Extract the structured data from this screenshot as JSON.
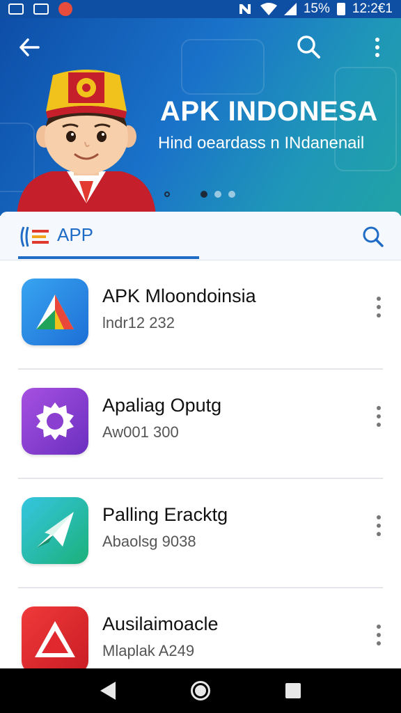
{
  "status_bar": {
    "time": "12:2€1",
    "battery": "15%"
  },
  "header": {
    "title": "APK INDONESA",
    "subtitle": "Hind oeardass n INdanenail",
    "carousel": {
      "count": 4,
      "active_index": 1
    }
  },
  "tab": {
    "label": "APP"
  },
  "apps": [
    {
      "name": "APK Mloondoinsia",
      "meta": "lndr12 232",
      "icon": "tent-triangle-icon",
      "color": "#2e8fe6"
    },
    {
      "name": "Apaliag Oputg",
      "meta": "Aw001 300",
      "icon": "gear-icon",
      "color": "#8a3fd1"
    },
    {
      "name": "Palling Eracktg",
      "meta": "Abaolsg 9038",
      "icon": "paper-plane-icon",
      "color": "#23b3b8"
    },
    {
      "name": "Ausilaimoacle",
      "meta": "Mlaplak A249",
      "icon": "warning-triangle-icon",
      "color": "#e0282e"
    }
  ]
}
